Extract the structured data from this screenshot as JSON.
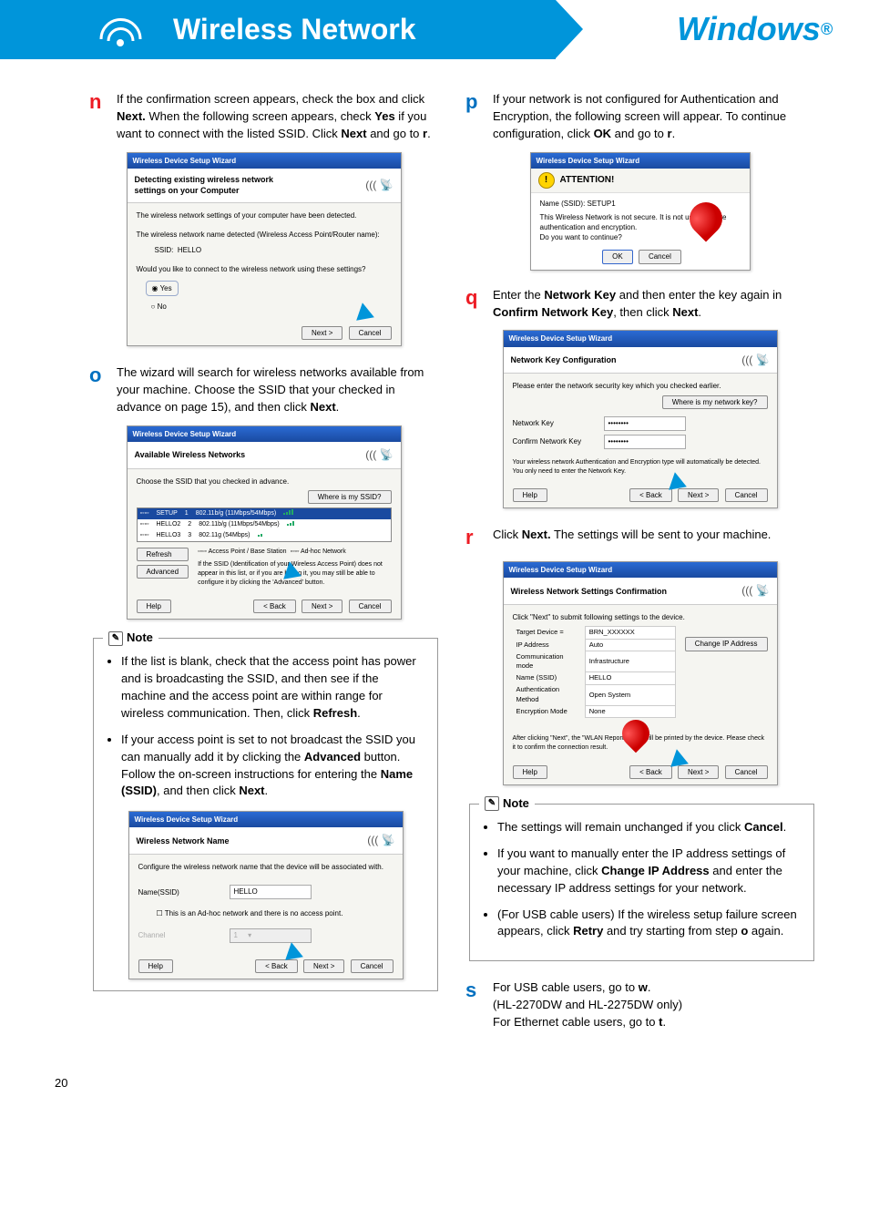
{
  "header": {
    "title_left": "Wireless Network",
    "title_right": "Windows",
    "title_right_sup": "®"
  },
  "steps": {
    "n": {
      "letter": "n",
      "text_pre": "If the confirmation screen appears, check the box and click ",
      "b1": "Next.",
      "text_mid1": " When the following screen appears, check ",
      "b2": "Yes",
      "text_mid2": " if you want to connect with the listed SSID. Click ",
      "b3": "Next",
      "text_mid3": " and go to ",
      "b4": "r",
      "text_end": "."
    },
    "o": {
      "letter": "o",
      "text_pre": "The wizard will search for wireless networks available from your machine. Choose the SSID that your checked in advance on page 15), and then click ",
      "b1": "Next",
      "text_end": "."
    },
    "p": {
      "letter": "p",
      "text_pre": "If your network is not configured for Authentication and Encryption, the following screen will appear. To continue configuration, click ",
      "b1": "OK",
      "text_mid1": " and go to ",
      "b2": "r",
      "text_end": "."
    },
    "q": {
      "letter": "q",
      "text_pre": "Enter the ",
      "b1": "Network Key",
      "text_mid1": " and then enter the key again in ",
      "b2": "Confirm Network Key",
      "text_mid2": ", then click ",
      "b3": "Next",
      "text_end": "."
    },
    "r": {
      "letter": "r",
      "text_pre": "Click ",
      "b1": "Next.",
      "text_end": " The settings will be sent to your machine."
    },
    "s": {
      "letter": "s",
      "line1_pre": "For USB cable users, go to ",
      "line1_b": "w",
      "line1_end": ".",
      "line2": "(HL-2270DW and HL-2275DW only)",
      "line3_pre": "For Ethernet cable users, go to ",
      "line3_b": "t",
      "line3_end": "."
    }
  },
  "dialog_common": {
    "title": "Wireless Device Setup Wizard",
    "btn_next": "Next >",
    "btn_back": "< Back",
    "btn_cancel": "Cancel",
    "btn_help": "Help",
    "btn_ok": "OK",
    "btn_refresh": "Refresh",
    "btn_advanced": "Advanced"
  },
  "dialog_n": {
    "head": "Detecting existing wireless network settings on your Computer",
    "line1": "The wireless network settings of your computer have been detected.",
    "line2": "The wireless network name detected (Wireless Access Point/Router name):",
    "ssid_label": "SSID:",
    "ssid_value": "HELLO",
    "line3": "Would you like to connect to the wireless network using these settings?",
    "opt_yes": "Yes",
    "opt_no": "No"
  },
  "dialog_o": {
    "head": "Available Wireless Networks",
    "sub": "Choose the SSID that you checked in advance.",
    "where": "Where is my SSID?",
    "row1": {
      "name": "SETUP",
      "ch": "1",
      "mode": "802.11b/g (11Mbps/54Mbps)"
    },
    "row2": {
      "name": "HELLO2",
      "ch": "2",
      "mode": "802.11b/g (11Mbps/54Mbps)"
    },
    "row3": {
      "name": "HELLO3",
      "ch": "3",
      "mode": "802.11g (54Mbps)"
    },
    "ap_label": "Access Point / Base Station",
    "ah_label": "Ad-hoc Network",
    "hint": "If the SSID (Identification of your Wireless Access Point) does not appear in this list, or if you are hiding it, you may still be able to configure it by clicking the 'Advanced' button."
  },
  "dialog_name": {
    "head": "Wireless Network Name",
    "sub": "Configure the wireless network name that the device will be associated with.",
    "name_label": "Name(SSID)",
    "name_value": "HELLO",
    "checkbox": "This is an Ad-hoc network and there is no access point.",
    "channel_label": "Channel"
  },
  "dialog_attn": {
    "head": "ATTENTION!",
    "name_label": "Name (SSID):",
    "name_value": "SETUP1",
    "warn1": "This Wireless Network is not secure. It is not using secure authentication and encryption.",
    "warn2": "Do you want to continue?"
  },
  "dialog_q": {
    "head": "Network Key Configuration",
    "sub": "Please enter the network security key which you checked earlier.",
    "where": "Where is my network key?",
    "key_label": "Network Key",
    "confirm_label": "Confirm Network Key",
    "placeholder": "••••••••",
    "hint": "Your wireless network Authentication and Encryption type will automatically be detected. You only need to enter the Network Key."
  },
  "dialog_r": {
    "head": "Wireless Network Settings Confirmation",
    "sub": "Click \"Next\" to submit following settings to the device.",
    "btn_change": "Change IP Address",
    "rows": {
      "target": {
        "k": "Target Device =",
        "v": "BRN_XXXXXX"
      },
      "ip": {
        "k": "IP Address",
        "v": "Auto"
      },
      "comm": {
        "k": "Communication mode",
        "v": "Infrastructure"
      },
      "ssid": {
        "k": "Name (SSID)",
        "v": "HELLO"
      },
      "auth": {
        "k": "Authentication Method",
        "v": "Open System"
      },
      "enc": {
        "k": "Encryption Mode",
        "v": "None"
      }
    },
    "foot": "After clicking \"Next\", the \"WLAN Report\" Page will be printed by the device. Please check it to confirm the connection result."
  },
  "notes": {
    "title": "Note",
    "left": {
      "li1_pre": "If the list is blank, check that the access point has power and is broadcasting the SSID, and then see if the machine and the access point are within range for wireless communication. Then, click ",
      "li1_b": "Refresh",
      "li1_end": ".",
      "li2_pre": "If your access point is set to not broadcast the SSID you can manually add it by clicking the ",
      "li2_b1": "Advanced",
      "li2_mid": " button. Follow the on-screen instructions for entering the ",
      "li2_b2": "Name (SSID)",
      "li2_mid2": ", and then click ",
      "li2_b3": "Next",
      "li2_end": "."
    },
    "right": {
      "li1_pre": "The settings will remain unchanged if you click ",
      "li1_b": "Cancel",
      "li1_end": ".",
      "li2_pre": "If you want to manually enter the IP address settings of your machine, click ",
      "li2_b": "Change IP Address",
      "li2_end": " and enter the necessary IP address settings for your network.",
      "li3_pre": "(For USB cable users) If the wireless setup failure screen appears, click ",
      "li3_b1": "Retry",
      "li3_mid": " and try starting from step ",
      "li3_b2": "o",
      "li3_end": " again."
    }
  },
  "page_number": "20"
}
